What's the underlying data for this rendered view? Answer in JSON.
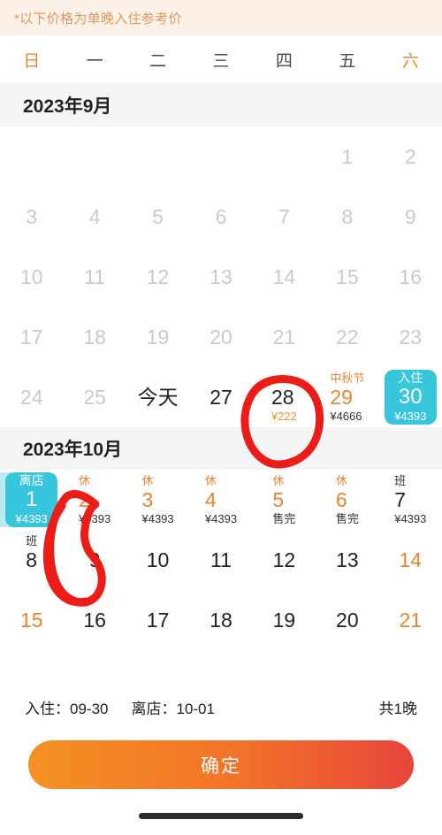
{
  "notice": {
    "text": "*以下价格为单晚入住参考价"
  },
  "weekdays": [
    {
      "label": "日",
      "accent": true
    },
    {
      "label": "一",
      "accent": false
    },
    {
      "label": "二",
      "accent": false
    },
    {
      "label": "三",
      "accent": false
    },
    {
      "label": "四",
      "accent": false
    },
    {
      "label": "五",
      "accent": false
    },
    {
      "label": "六",
      "accent": true
    }
  ],
  "months": [
    {
      "title": "2023年9月",
      "lead_blank": 5,
      "days": [
        {
          "num": "1",
          "state": "disabled"
        },
        {
          "num": "2",
          "state": "disabled"
        },
        {
          "num": "3",
          "state": "disabled"
        },
        {
          "num": "4",
          "state": "disabled"
        },
        {
          "num": "5",
          "state": "disabled"
        },
        {
          "num": "6",
          "state": "disabled"
        },
        {
          "num": "7",
          "state": "disabled"
        },
        {
          "num": "8",
          "state": "disabled"
        },
        {
          "num": "9",
          "state": "disabled"
        },
        {
          "num": "10",
          "state": "disabled"
        },
        {
          "num": "11",
          "state": "disabled"
        },
        {
          "num": "12",
          "state": "disabled"
        },
        {
          "num": "13",
          "state": "disabled"
        },
        {
          "num": "14",
          "state": "disabled"
        },
        {
          "num": "15",
          "state": "disabled"
        },
        {
          "num": "16",
          "state": "disabled"
        },
        {
          "num": "17",
          "state": "disabled"
        },
        {
          "num": "18",
          "state": "disabled"
        },
        {
          "num": "19",
          "state": "disabled"
        },
        {
          "num": "20",
          "state": "disabled"
        },
        {
          "num": "21",
          "state": "disabled"
        },
        {
          "num": "22",
          "state": "disabled"
        },
        {
          "num": "23",
          "state": "disabled"
        },
        {
          "num": "24",
          "state": "disabled"
        },
        {
          "num": "25",
          "state": "disabled"
        },
        {
          "num": "今天",
          "state": "today"
        },
        {
          "num": "27",
          "state": "normal"
        },
        {
          "num": "28",
          "state": "normal",
          "price": "¥222",
          "price_style": "orange"
        },
        {
          "num": "29",
          "state": "accent",
          "tag": "中秋节",
          "tag_style": "fest",
          "price": "¥4666"
        },
        {
          "num": "30",
          "state": "selected-start",
          "tag": "入住",
          "price": "¥4393"
        }
      ]
    },
    {
      "title": "2023年10月",
      "lead_blank": 0,
      "days": [
        {
          "num": "1",
          "state": "selected-end",
          "tag": "离店",
          "price": "¥4393"
        },
        {
          "num": "2",
          "state": "accent",
          "tag": "休",
          "price": "¥4393"
        },
        {
          "num": "3",
          "state": "accent",
          "tag": "休",
          "price": "¥4393"
        },
        {
          "num": "4",
          "state": "accent",
          "tag": "休",
          "price": "¥4393"
        },
        {
          "num": "5",
          "state": "accent",
          "tag": "休",
          "price": "售完"
        },
        {
          "num": "6",
          "state": "accent",
          "tag": "休",
          "price": "售完"
        },
        {
          "num": "7",
          "state": "normal",
          "tag": "班",
          "tag_style": "work",
          "price": "¥4393"
        },
        {
          "num": "8",
          "state": "normal",
          "tag": "班",
          "tag_style": "work"
        },
        {
          "num": "9",
          "state": "normal"
        },
        {
          "num": "10",
          "state": "normal"
        },
        {
          "num": "11",
          "state": "normal"
        },
        {
          "num": "12",
          "state": "normal"
        },
        {
          "num": "13",
          "state": "normal"
        },
        {
          "num": "14",
          "state": "accent"
        },
        {
          "num": "15",
          "state": "accent"
        },
        {
          "num": "16",
          "state": "normal"
        },
        {
          "num": "17",
          "state": "normal"
        },
        {
          "num": "18",
          "state": "normal"
        },
        {
          "num": "19",
          "state": "normal"
        },
        {
          "num": "20",
          "state": "normal"
        },
        {
          "num": "21",
          "state": "accent"
        }
      ]
    }
  ],
  "summary": {
    "checkin": "入住：09-30",
    "checkout": "离店：10-01",
    "nights": "共1晚"
  },
  "confirm": {
    "label": "确定"
  },
  "colors": {
    "accent_orange": "#E8852C",
    "selected_cyan": "#37C6DC",
    "notice_bg": "#FDF0E7",
    "ink_red": "#ED1C16",
    "button_from": "#F59124",
    "button_to": "#E8453C"
  }
}
